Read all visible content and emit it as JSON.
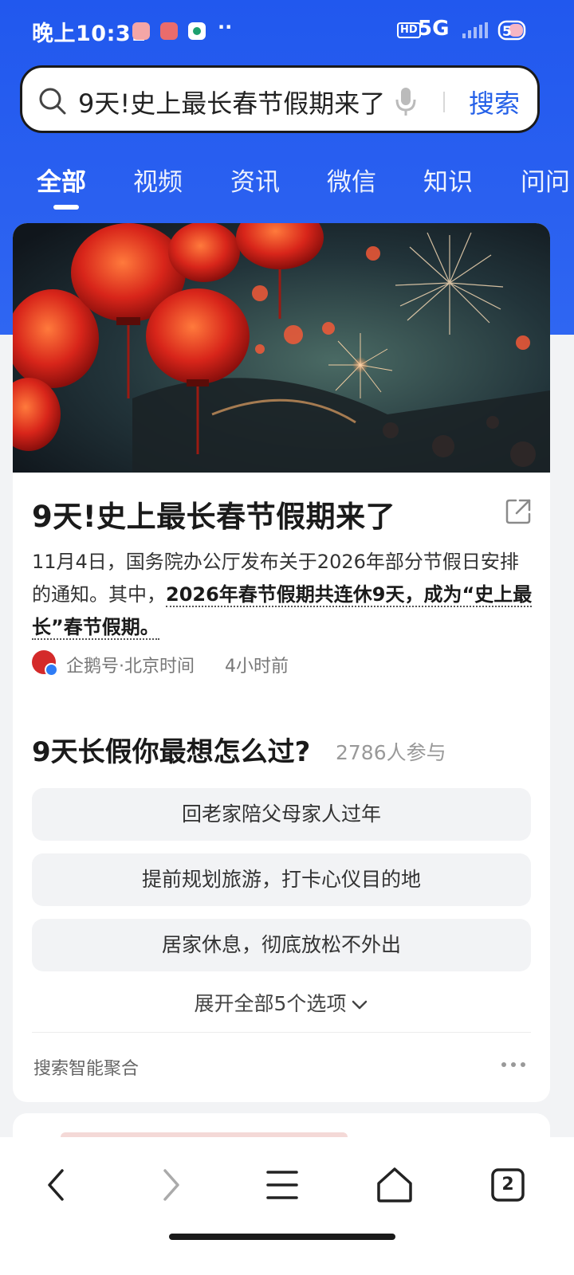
{
  "status_bar": {
    "time": "晚上10:31",
    "network": "5G",
    "hd_badge": "HD",
    "dots": "··"
  },
  "search": {
    "query": "9天!史上最长春节假期来了",
    "button_label": "搜索",
    "icons": [
      "search-icon",
      "microphone-icon"
    ]
  },
  "tabs": [
    {
      "label": "全部",
      "active": true
    },
    {
      "label": "视频",
      "active": false
    },
    {
      "label": "资讯",
      "active": false
    },
    {
      "label": "微信",
      "active": false
    },
    {
      "label": "知识",
      "active": false
    },
    {
      "label": "问问",
      "active": false
    }
  ],
  "article": {
    "title": "9天!史上最长春节假期来了",
    "summary_plain": "11月4日，国务院办公厅发布关于2026年部分节假日安排的通知。其中，",
    "summary_emphasis": "2026年春节假期共连休9天，成为“史上最长”春节假期。",
    "source": "企鹅号·北京时间",
    "time": "4小时前"
  },
  "poll": {
    "question": "9天长假你最想怎么过?",
    "participants": "2786人参与",
    "options": [
      "回老家陪父母家人过年",
      "提前规划旅游，打卡心仪目的地",
      "居家休息，彻底放松不外出"
    ],
    "expand_label": "展开全部5个选项"
  },
  "card_footer": {
    "label": "搜索智能聚合"
  },
  "bottom_nav": {
    "tabs_count": "2",
    "icons": [
      "back-icon",
      "forward-icon",
      "menu-icon",
      "home-icon",
      "tabs-icon"
    ]
  },
  "colors": {
    "brand_blue": "#2a60f0",
    "search_button": "#2460e8"
  }
}
